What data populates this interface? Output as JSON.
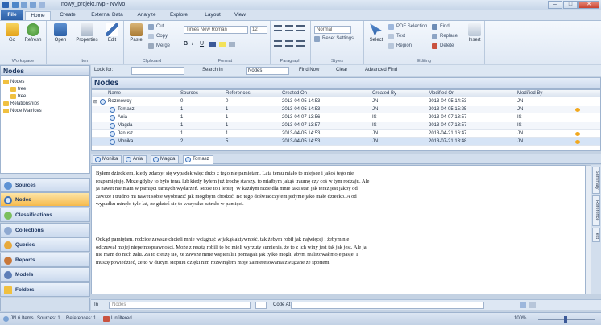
{
  "window": {
    "title": "nowy_projekt.nvp - NVivo",
    "controls": [
      "–",
      "□",
      "✕"
    ]
  },
  "ribbon_tabs": [
    {
      "label": "File"
    },
    {
      "label": "Home"
    },
    {
      "label": "Create"
    },
    {
      "label": "External Data"
    },
    {
      "label": "Analyze"
    },
    {
      "label": "Explore"
    },
    {
      "label": "Layout"
    },
    {
      "label": "View"
    }
  ],
  "ribbon": {
    "workspace": {
      "go": "Go",
      "refresh": "Refresh",
      "label": "Workspace"
    },
    "item": {
      "open": "Open",
      "properties": "Properties",
      "edit": "Edit",
      "label": "Item"
    },
    "clipboard": {
      "paste": "Paste",
      "cut": "Cut",
      "copy": "Copy",
      "merge": "Merge",
      "label": "Clipboard"
    },
    "format": {
      "font": "Times New Roman",
      "size": "12",
      "label": "Format"
    },
    "paragraph": {
      "label": "Paragraph"
    },
    "styles": {
      "style": "Normal",
      "reset": "Reset Settings",
      "label": "Styles"
    },
    "editing": {
      "select": "Select",
      "pdf_selection": "PDF Selection",
      "text": "Text",
      "region": "Region",
      "find": "Find",
      "replace": "Replace",
      "delete": "Delete",
      "insert": "Insert",
      "label": "Editing"
    }
  },
  "nav": {
    "header": "Nodes",
    "tree": [
      {
        "label": "Nodes"
      },
      {
        "label": "tree"
      },
      {
        "label": "tree"
      },
      {
        "label": "Relationships"
      },
      {
        "label": "Node Matrices"
      }
    ],
    "buttons": [
      {
        "label": "Sources"
      },
      {
        "label": "Nodes"
      },
      {
        "label": "Classifications"
      },
      {
        "label": "Collections"
      },
      {
        "label": "Queries"
      },
      {
        "label": "Reports"
      },
      {
        "label": "Models"
      },
      {
        "label": "Folders"
      }
    ]
  },
  "findbar": {
    "look_for_label": "Look for:",
    "search_in_label": "Search In",
    "search_in_value": "Nodes",
    "find_now": "Find Now",
    "clear": "Clear",
    "advanced_find": "Advanced Find"
  },
  "list": {
    "title": "Nodes",
    "columns": [
      "Name",
      "Sources",
      "References",
      "Created On",
      "Created By",
      "Modified On",
      "Modified By"
    ],
    "rows": [
      {
        "name": "Rozmówcy",
        "sources": "0",
        "references": "0",
        "created_on": "2013-04-05 14:53",
        "created_by": "JN",
        "modified_on": "2013-04-05 14:53",
        "modified_by": "JN"
      },
      {
        "name": "Tomasz",
        "sources": "1",
        "references": "1",
        "created_on": "2013-04-05 14:53",
        "created_by": "JN",
        "modified_on": "2013-04-05 15:25",
        "modified_by": "JN"
      },
      {
        "name": "Ania",
        "sources": "1",
        "references": "1",
        "created_on": "2013-04-07 13:56",
        "created_by": "IS",
        "modified_on": "2013-04-07 13:57",
        "modified_by": "IS"
      },
      {
        "name": "Magda",
        "sources": "1",
        "references": "1",
        "created_on": "2013-04-07 13:57",
        "created_by": "IS",
        "modified_on": "2013-04-07 13:57",
        "modified_by": "IS"
      },
      {
        "name": "Janusz",
        "sources": "1",
        "references": "1",
        "created_on": "2013-04-05 14:53",
        "created_by": "JN",
        "modified_on": "2013-04-21 16:47",
        "modified_by": "JN"
      },
      {
        "name": "Monika",
        "sources": "2",
        "references": "5",
        "created_on": "2013-04-05 14:53",
        "created_by": "JN",
        "modified_on": "2013-07-21 13:48",
        "modified_by": "JN"
      }
    ]
  },
  "doc_tabs": [
    {
      "label": "Monika"
    },
    {
      "label": "Ania"
    },
    {
      "label": "Magda"
    },
    {
      "label": "Tomasz"
    }
  ],
  "document": {
    "paragraphs": [
      "Byłem dzieckiem, kiedy zdarzył się wypadek więc dużo z tego nie pamiętam. Lata temu miało to miejsce i jakoś tego nie rozpamiętuję. Może gdyby to było teraz lub kiedy byłem już trochę starszy, to miałbym jakąś traumę czy coś w tym rodzaju. Ale ja nawet nie mam w pamięci tamtych wydarzeń. Może to i lepiej. W każdym razie dla mnie taki stan jak teraz jest jakby od zawsze i trudno mi nawet sobie wyobrazić jak mógłbym chodzić. Bo tego doświadczyłem jedynie jako małe dziecko. A od wypadku minęło tyle lat, że gdzieś się to wszystko zatrało w pamięci.",
      "Odkąd pamiętam, rodzice zawsze chcieli mnie wciągnąć w jakąś aktywność, tak żebym robił jak najwięcej i żebym nie odczuwał mojej niepełnosprawności. Może z resztą robili to bo mieli wyrzuty sumienia, że to z ich winy jest tak jak jest. Ale ja nie mam do nich żalu. Za to cieszę się, że zawsze mnie wspierali i pomagali jak tylko mogli, abym realizował moje pasje. I muszę powiedzieć, że to w dużym stopniu dzięki nim rozwinąłem moje zainteresowania związane ze sportem."
    ],
    "side_tabs": [
      "Summary",
      "Reference",
      "Text"
    ]
  },
  "bottom_bar": {
    "in_label": "In",
    "in_value": "Nodes",
    "code_at": "Code At"
  },
  "status": {
    "user": "JN",
    "items": "6 Items",
    "sources": "Sources: 1",
    "references": "References: 1",
    "state": "Unfiltered",
    "zoom": "100%"
  }
}
